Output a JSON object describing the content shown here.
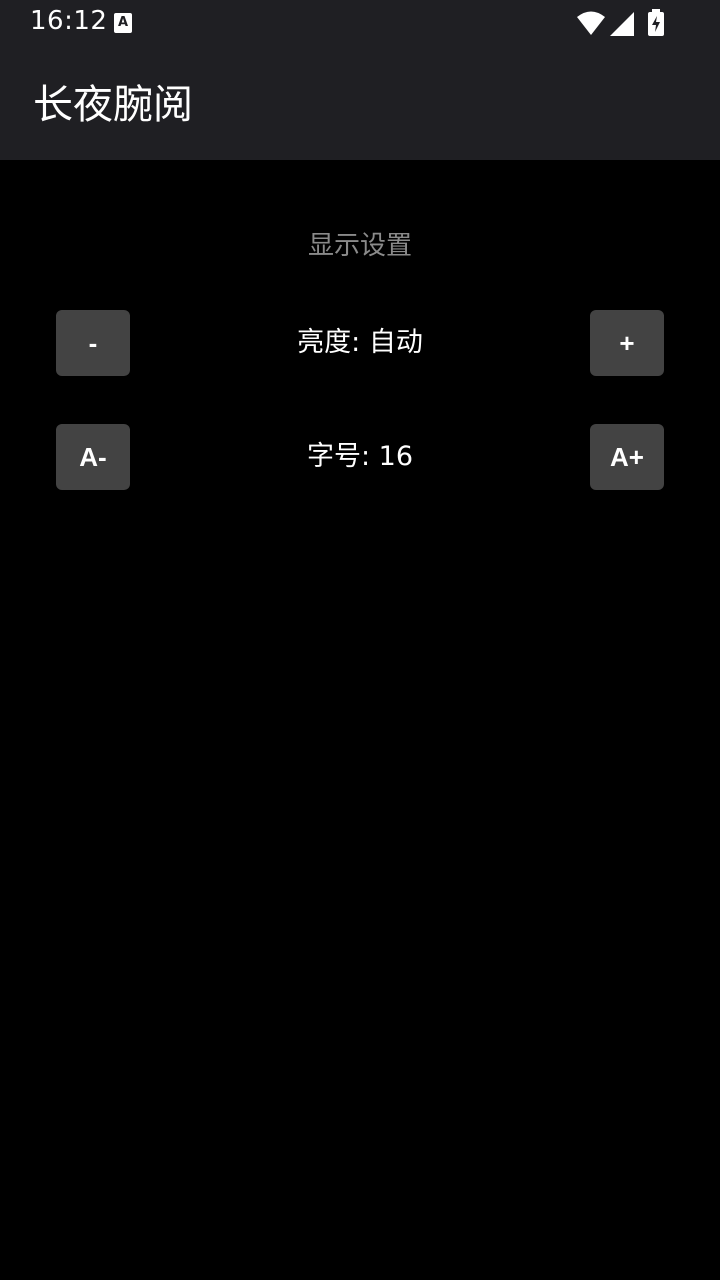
{
  "status_bar": {
    "time": "16:12",
    "notification_icon_letter": "A",
    "icons": [
      "notification-icon",
      "wifi-icon",
      "signal-icon",
      "battery-charging-icon"
    ]
  },
  "app_bar": {
    "title": "长夜腕阅"
  },
  "settings": {
    "section_title": "显示设置",
    "brightness": {
      "decrease_label": "-",
      "label": "亮度: 自动",
      "increase_label": "+"
    },
    "font_size": {
      "decrease_label": "A-",
      "label": "字号: 16",
      "increase_label": "A+"
    }
  },
  "colors": {
    "background": "#000000",
    "bar": "#1f1f23",
    "button": "#434343",
    "section_title": "#8a8a8a"
  }
}
